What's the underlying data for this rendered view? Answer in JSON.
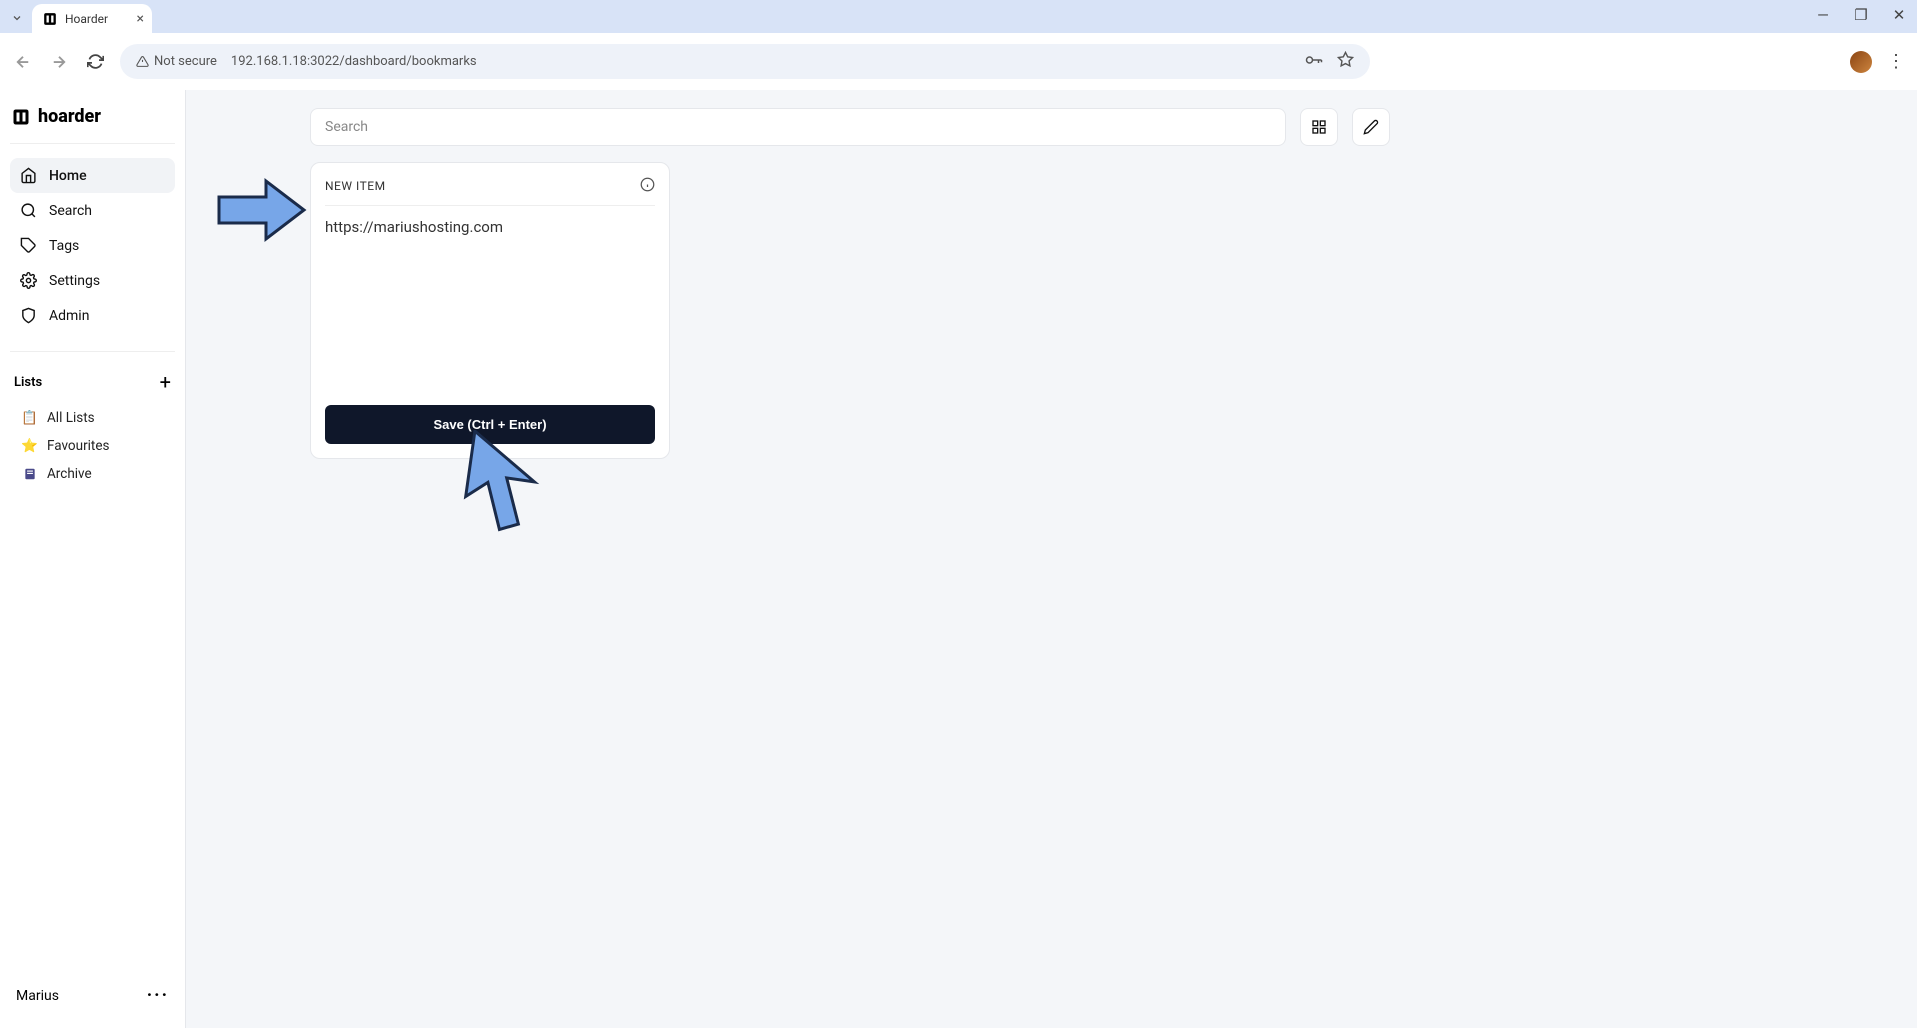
{
  "browser": {
    "tab_title": "Hoarder",
    "security_label": "Not secure",
    "url": "192.168.1.18:3022/dashboard/bookmarks"
  },
  "app": {
    "brand": "hoarder",
    "nav": {
      "home": "Home",
      "search": "Search",
      "tags": "Tags",
      "settings": "Settings",
      "admin": "Admin"
    },
    "lists": {
      "header": "Lists",
      "all": "All Lists",
      "favourites": "Favourites",
      "archive": "Archive"
    },
    "user": "Marius"
  },
  "main": {
    "search_placeholder": "Search",
    "new_item_label": "NEW ITEM",
    "url_value": "https://mariushosting.com",
    "save_button": "Save (Ctrl + Enter)"
  }
}
